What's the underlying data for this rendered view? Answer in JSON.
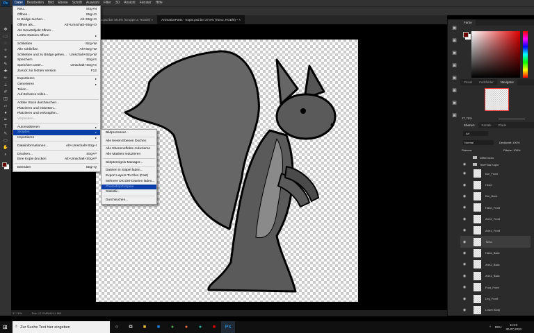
{
  "menubar": {
    "items": [
      "Datei",
      "Bearbeiten",
      "Bild",
      "Ebene",
      "Schrift",
      "Auswahl",
      "Filter",
      "3D",
      "Ansicht",
      "Fenster",
      "Hilfe"
    ],
    "active": "Datei"
  },
  "doc_tabs": [
    {
      "label": "...ew.psd bei 56,6% (Gruppe 3, RGB/8)",
      "close": "×"
    },
    {
      "label": "AnimationParts - Kopie.psd bei 37,8% (Torso, RGB/8) *",
      "close": "×"
    }
  ],
  "file_menu": [
    {
      "label": "Neu...",
      "shortcut": "Strg+N"
    },
    {
      "label": "Öffnen...",
      "shortcut": "Strg+O"
    },
    {
      "label": "In Bridge suchen...",
      "shortcut": "Alt+Strg+O"
    },
    {
      "label": "Öffnen als...",
      "shortcut": "Alt+Umschalt+Strg+O"
    },
    {
      "label": "Als Smartobjekt öffnen..."
    },
    {
      "label": "Letzte Dateien öffnen",
      "submenu": true
    },
    {
      "sep": true
    },
    {
      "label": "Schließen",
      "shortcut": "Strg+W"
    },
    {
      "label": "Alle schließen",
      "shortcut": "Alt+Strg+W"
    },
    {
      "label": "Schließen und zu Bridge gehen...",
      "shortcut": "Umschalt+Strg+W"
    },
    {
      "label": "Speichern",
      "shortcut": "Strg+S"
    },
    {
      "label": "Speichern unter...",
      "shortcut": "Umschalt+Strg+S"
    },
    {
      "label": "Zurück zur letzten Version",
      "shortcut": "F12"
    },
    {
      "sep": true
    },
    {
      "label": "Exportieren",
      "submenu": true
    },
    {
      "label": "Generieren",
      "submenu": true
    },
    {
      "label": "Teilen..."
    },
    {
      "label": "Auf Behance teilen..."
    },
    {
      "sep": true
    },
    {
      "label": "Adobe Stock durchsuchen..."
    },
    {
      "label": "Platzieren und einbetten..."
    },
    {
      "label": "Platzieren und verknüpfen..."
    },
    {
      "label": "Verpacken...",
      "disabled": true
    },
    {
      "sep": true
    },
    {
      "label": "Automatisieren",
      "submenu": true
    },
    {
      "label": "Skripten",
      "submenu": true,
      "highlighted": true
    },
    {
      "label": "Importieren",
      "submenu": true
    },
    {
      "sep": true
    },
    {
      "label": "Dateiinformationen...",
      "shortcut": "Alt+Umschalt+Strg+I"
    },
    {
      "sep": true
    },
    {
      "label": "Drucken...",
      "shortcut": "Strg+P"
    },
    {
      "label": "Eine Kopie drucken",
      "shortcut": "Alt+Umschalt+Strg+P"
    },
    {
      "sep": true
    },
    {
      "label": "Beenden",
      "shortcut": "Strg+Q"
    }
  ],
  "scripts_menu": [
    {
      "label": "Bildprozessor..."
    },
    {
      "sep": true
    },
    {
      "label": "Alle leeren Ebenen löschen"
    },
    {
      "sep": true
    },
    {
      "label": "Alle Ebeneneffekte reduzieren"
    },
    {
      "label": "Alle Masken reduzieren"
    },
    {
      "sep": true
    },
    {
      "label": "Skriptereignis-Manager..."
    },
    {
      "sep": true
    },
    {
      "label": "Dateien in Stapel laden..."
    },
    {
      "label": "Export Layers To Files (Fast)"
    },
    {
      "label": "Mehrere DICOM-Dateien laden..."
    },
    {
      "label": "PhotoshopToSpine",
      "highlighted": true
    },
    {
      "label": "Statistik..."
    },
    {
      "sep": true
    },
    {
      "label": "Durchsuchen..."
    }
  ],
  "color_panel": {
    "tab": "Farbe",
    "foreground": "#6b0000",
    "background": "#ffffff"
  },
  "nav_panel": {
    "tabs": [
      "Pinsel",
      "Farbfelder",
      "Navigator"
    ],
    "active": "Navigator",
    "zoom": "37,76%"
  },
  "layers_panel": {
    "tabs": [
      "Ebenen",
      "Kanäle",
      "Pfade"
    ],
    "active": "Ebenen",
    "filter": "Art",
    "blend_mode": "Normal",
    "opacity_label": "Deckkraft:",
    "opacity": "100%",
    "lock_label": "Fixieren:",
    "fill_label": "Fläche:",
    "fill": "100%",
    "layers": [
      {
        "name": "Differences",
        "group": true,
        "visible": false
      },
      {
        "name": "TeleFinal Kopie",
        "group": true,
        "visible": true
      },
      {
        "name": "Ear_Front"
      },
      {
        "name": "Head"
      },
      {
        "name": "Ear_Back"
      },
      {
        "name": "Hand_Front"
      },
      {
        "name": "Arm2_Front"
      },
      {
        "name": "Arm1_Front"
      },
      {
        "name": "Torso",
        "selected": true
      },
      {
        "name": "Hand_Back"
      },
      {
        "name": "Arm2_Back"
      },
      {
        "name": "Arm1_Back"
      },
      {
        "name": "Foot_Front"
      },
      {
        "name": "Leg_Front"
      },
      {
        "name": "Lower Body"
      }
    ]
  },
  "status": {
    "zoom": "37,76%",
    "doc": "Dok: 17,9 MB/404,1 MB"
  },
  "taskbar": {
    "search_placeholder": "Zur Suche Text hier eingeben",
    "lang": "DEU",
    "time": "11:23",
    "date": "30.07.2020"
  }
}
